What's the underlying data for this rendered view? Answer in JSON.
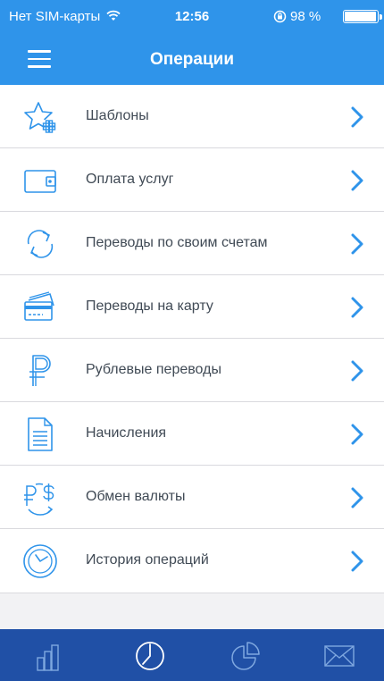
{
  "status_bar": {
    "carrier": "Нет SIM-карты",
    "time": "12:56",
    "battery_percent": "98 %",
    "battery_level": 0.98,
    "icons": [
      "wifi-icon",
      "orientation-lock-icon",
      "battery-icon"
    ]
  },
  "header": {
    "title": "Операции",
    "menu_icon": "hamburger-menu-icon"
  },
  "operations": [
    {
      "label": "Шаблоны",
      "icon": "star-plus-icon"
    },
    {
      "label": "Оплата услуг",
      "icon": "wallet-icon"
    },
    {
      "label": "Переводы по своим счетам",
      "icon": "exchange-arrows-icon"
    },
    {
      "label": "Переводы на карту",
      "icon": "cards-icon"
    },
    {
      "label": "Рублевые переводы",
      "icon": "ruble-icon"
    },
    {
      "label": "Начисления",
      "icon": "document-icon"
    },
    {
      "label": "Обмен валюты",
      "icon": "currency-exchange-icon"
    },
    {
      "label": "История операций",
      "icon": "clock-icon"
    }
  ],
  "tab_bar": {
    "tabs": [
      {
        "icon": "bar-chart-icon",
        "active": false
      },
      {
        "icon": "clock-icon",
        "active": true
      },
      {
        "icon": "pie-chart-icon",
        "active": false
      },
      {
        "icon": "mail-icon",
        "active": false
      }
    ]
  },
  "colors": {
    "header_bg": "#2f94ea",
    "tabbar_bg": "#2050a6",
    "accent": "#2f94ea",
    "text": "#404a55",
    "page_bg": "#f2f2f4"
  }
}
